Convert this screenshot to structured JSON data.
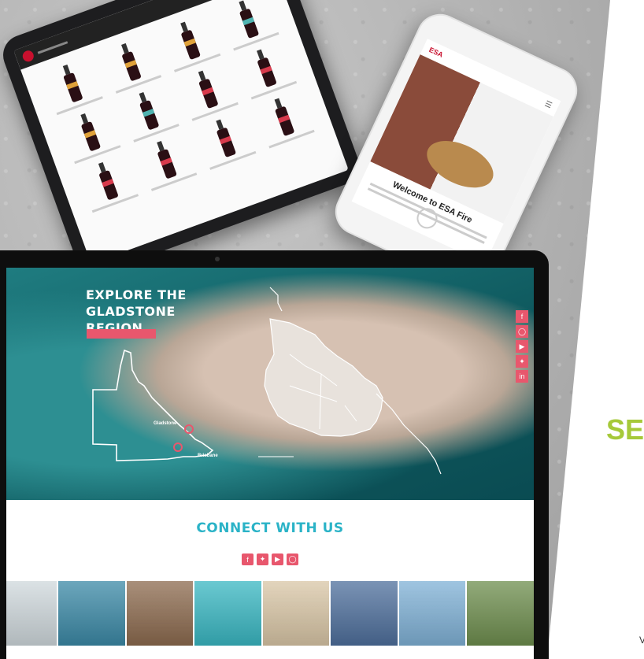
{
  "phone": {
    "logo": "ESA",
    "welcome": "Welcome to ESA Fire"
  },
  "hero": {
    "title": "EXPLORE THE GLADSTONE REGION",
    "cities": [
      "Gladstone",
      "Brisbane"
    ]
  },
  "social_icons": [
    "facebook-icon",
    "instagram-icon",
    "youtube-icon",
    "twitter-icon",
    "linkedin-icon"
  ],
  "connect": {
    "title": "CONNECT WITH US",
    "icons": [
      "facebook-icon",
      "twitter-icon",
      "youtube-icon",
      "instagram-icon"
    ]
  },
  "gallery": {
    "photos": [
      {
        "name": "beach-photo",
        "color": "#cfd8dc"
      },
      {
        "name": "kayak-island-photo",
        "color": "#3b89a6"
      },
      {
        "name": "forest-photo",
        "color": "#8c6a4e"
      },
      {
        "name": "turquoise-water-photo",
        "color": "#39b7c2"
      },
      {
        "name": "sand-turtle-photo",
        "color": "#d9c6a6"
      },
      {
        "name": "sunset-kayak-photo",
        "color": "#4e6f9c"
      },
      {
        "name": "rocky-shore-photo",
        "color": "#7fb1d6"
      },
      {
        "name": "headland-photo",
        "color": "#6e8e4e"
      }
    ]
  },
  "side_panel": {
    "heading_fragment": "SE",
    "corner_fragment": "V"
  },
  "colors": {
    "accent_pink": "#e8576d",
    "teal": "#2bb3c7",
    "lime": "#a6c93a"
  }
}
